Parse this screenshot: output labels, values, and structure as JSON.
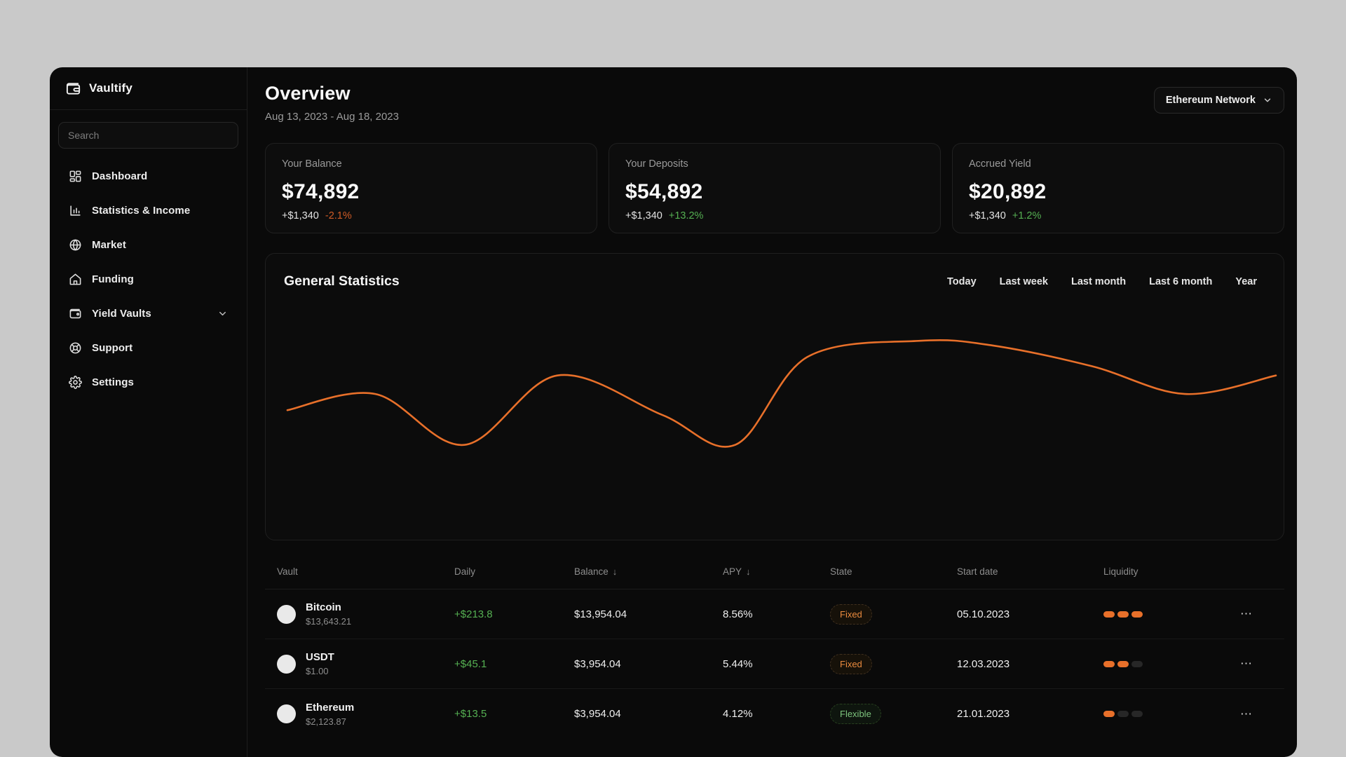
{
  "app": {
    "name": "Vaultify"
  },
  "sidebar": {
    "search_placeholder": "Search",
    "items": [
      {
        "label": "Dashboard",
        "icon": "dashboard-icon",
        "has_chevron": false
      },
      {
        "label": "Statistics & Income",
        "icon": "bar-chart-icon",
        "has_chevron": false
      },
      {
        "label": "Market",
        "icon": "globe-icon",
        "has_chevron": false
      },
      {
        "label": "Funding",
        "icon": "home-icon",
        "has_chevron": false
      },
      {
        "label": "Yield Vaults",
        "icon": "wallet-icon",
        "has_chevron": true
      },
      {
        "label": "Support",
        "icon": "lifebuoy-icon",
        "has_chevron": false
      },
      {
        "label": "Settings",
        "icon": "gear-icon",
        "has_chevron": false
      }
    ]
  },
  "header": {
    "title": "Overview",
    "date_range": "Aug 13, 2023 - Aug 18, 2023",
    "network_selector": "Ethereum Network"
  },
  "stat_cards": [
    {
      "label": "Your Balance",
      "value": "$74,892",
      "change_amount": "+$1,340",
      "change_percent": "-2.1%",
      "trend": "down"
    },
    {
      "label": "Your Deposits",
      "value": "$54,892",
      "change_amount": "+$1,340",
      "change_percent": "+13.2%",
      "trend": "up"
    },
    {
      "label": "Accrued Yield",
      "value": "$20,892",
      "change_amount": "+$1,340",
      "change_percent": "+1.2%",
      "trend": "up"
    }
  ],
  "statistics_panel": {
    "title": "General Statistics",
    "time_filters": [
      "Today",
      "Last week",
      "Last month",
      "Last 6 month",
      "Year"
    ],
    "chart_data": {
      "type": "line",
      "title": "General Statistics",
      "axes_visible": false,
      "grid": false,
      "legend": false,
      "line_color": "#E8702A",
      "note": "no numeric axis labels shown; values are percent of chart height (0=bottom, 100=top)",
      "series": [
        {
          "name": "portfolio-value",
          "x_pct": [
            0,
            8.9,
            17.9,
            27.3,
            37.9,
            45.3,
            52.6,
            64.0,
            71.3,
            81.4,
            90.8,
            100
          ],
          "y_pct": [
            56,
            63,
            41,
            71,
            54,
            41,
            79,
            86,
            84,
            75,
            63,
            71
          ]
        }
      ]
    }
  },
  "table": {
    "columns": [
      {
        "label": "Vault",
        "sorted": false
      },
      {
        "label": "Daily",
        "sorted": false
      },
      {
        "label": "Balance",
        "sorted": true
      },
      {
        "label": "APY",
        "sorted": true
      },
      {
        "label": "State",
        "sorted": false
      },
      {
        "label": "Start date",
        "sorted": false
      },
      {
        "label": "Liquidity",
        "sorted": false
      }
    ],
    "sort_icon": "↓",
    "more_icon": "⋯",
    "rows": [
      {
        "name": "Bitcoin",
        "price": "$13,643.21",
        "daily": "+$213.8",
        "balance": "$13,954.04",
        "apy": "8.56%",
        "state": "Fixed",
        "start_date": "05.10.2023",
        "liquidity_level": 3,
        "liquidity_max": 3
      },
      {
        "name": "USDT",
        "price": "$1.00",
        "daily": "+$45.1",
        "balance": "$3,954.04",
        "apy": "5.44%",
        "state": "Fixed",
        "start_date": "12.03.2023",
        "liquidity_level": 2,
        "liquidity_max": 3
      },
      {
        "name": "Ethereum",
        "price": "$2,123.87",
        "daily": "+$13.5",
        "balance": "$3,954.04",
        "apy": "4.12%",
        "state": "Flexible",
        "start_date": "21.01.2023",
        "liquidity_level": 1,
        "liquidity_max": 3
      }
    ]
  },
  "colors": {
    "accent_orange": "#E8702A",
    "positive_green": "#55B052",
    "negative_orange": "#CF5B26",
    "window_bg": "#0A0A0A",
    "desktop_bg": "#C9C9C9"
  }
}
